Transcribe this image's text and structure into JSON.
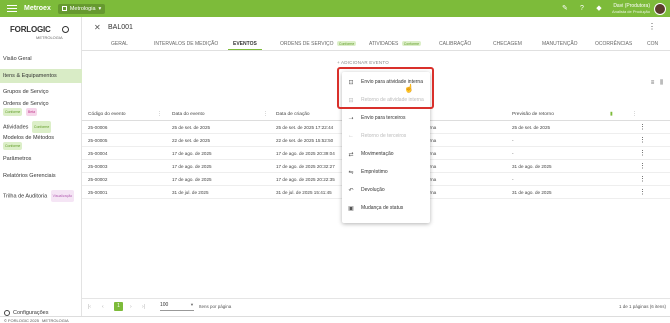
{
  "topbar": {
    "brand": "Metroex",
    "module": "Metrologia",
    "user_name": "Davi (Produtora)",
    "user_role": "Analista de Produção",
    "colors": {
      "accent": "#7dbb3a"
    },
    "icons": [
      "menu-icon",
      "chat-icon",
      "help-icon",
      "bell-icon"
    ]
  },
  "sidebar": {
    "logo_text": "FORLOGIC",
    "logo_sub": "METROLOGIA",
    "items": [
      {
        "label": "Visão Geral"
      },
      {
        "label": "Itens & Equipamentos"
      },
      {
        "label": "Grupos de Serviço"
      },
      {
        "label": "Ordens de Serviço",
        "badges": [
          "Conforme",
          "Beta"
        ]
      },
      {
        "label": "Atividades",
        "badges": [
          "Conforme"
        ]
      },
      {
        "label": "Modelos de Métodos",
        "badges": [
          "Conforme"
        ]
      },
      {
        "label": "Parâmetros"
      },
      {
        "label": "Relatórios Gerenciais"
      },
      {
        "label": "Trilha de Auditoria",
        "badges": [
          "Visualização"
        ]
      }
    ],
    "config_label": "Configurações"
  },
  "record": {
    "title": "BAL001",
    "tabs": [
      {
        "label": "GERAL"
      },
      {
        "label": "INTERVALOS DE MEDIÇÃO"
      },
      {
        "label": "EVENTOS"
      },
      {
        "label": "ORDENS DE SERVIÇO",
        "badge": "Conforme"
      },
      {
        "label": "ATIVIDADES",
        "badge": "Conforme"
      },
      {
        "label": "CALIBRAÇÃO"
      },
      {
        "label": "CHECAGEM"
      },
      {
        "label": "MANUTENÇÃO"
      },
      {
        "label": "OCORRÊNCIAS"
      },
      {
        "label": "CON"
      }
    ],
    "add_button": "+ ADICIONAR EVENTO"
  },
  "dropdown": {
    "items": [
      {
        "label": "Envio para atividade interna",
        "icon": "upload-box-icon",
        "disabled": false
      },
      {
        "label": "Retorno de atividade interna",
        "icon": "download-box-icon",
        "disabled": true
      },
      {
        "label": "Envio para terceiros",
        "icon": "arrow-right-icon",
        "disabled": false
      },
      {
        "label": "Retorno de terceiros",
        "icon": "arrow-left-icon",
        "disabled": true
      },
      {
        "label": "Movimentação",
        "icon": "move-icon",
        "disabled": false
      },
      {
        "label": "Empréstimo",
        "icon": "handshake-icon",
        "disabled": false
      },
      {
        "label": "Devolução",
        "icon": "return-icon",
        "disabled": false
      },
      {
        "label": "Mudança de status",
        "icon": "status-icon",
        "disabled": false
      }
    ]
  },
  "table": {
    "headers": [
      "Código do evento",
      "Data do evento",
      "Data de criação",
      "Previsão de retorno"
    ],
    "rows": [
      {
        "code": "25-00006",
        "event_date": "25 de set. de 2025",
        "created": "25 de set. de 2025 17:22:44",
        "type": "erna",
        "return": "25 de set. de 2025"
      },
      {
        "code": "25-00005",
        "event_date": "22 de set. de 2025",
        "created": "22 de set. de 2025 15:52:50",
        "type": "erna",
        "return": "-"
      },
      {
        "code": "25-00004",
        "event_date": "17 de ago. de 2025",
        "created": "17 de ago. de 2025 20:39:04",
        "type": "erna",
        "return": "-"
      },
      {
        "code": "25-00003",
        "event_date": "17 de ago. de 2025",
        "created": "17 de ago. de 2025 20:32:27",
        "type": "erna",
        "return": "31 de ago. de 2025"
      },
      {
        "code": "25-00002",
        "event_date": "17 de ago. de 2025",
        "created": "17 de ago. de 2025 20:22:35",
        "type": "erna",
        "return": "-"
      },
      {
        "code": "25-00001",
        "event_date": "31 de jul. de 2025",
        "created": "31 de jul. de 2025 15:41:45",
        "type": "erna",
        "return": "31 de ago. de 2025"
      }
    ]
  },
  "pager": {
    "current_page": "1",
    "per_page": "100",
    "per_page_label": "Itens por página",
    "summary": "1 de 1 páginas (6 itens)"
  },
  "footer": {
    "copyright": "© FORLOGIC 2025",
    "module": "METROLOGIA"
  }
}
